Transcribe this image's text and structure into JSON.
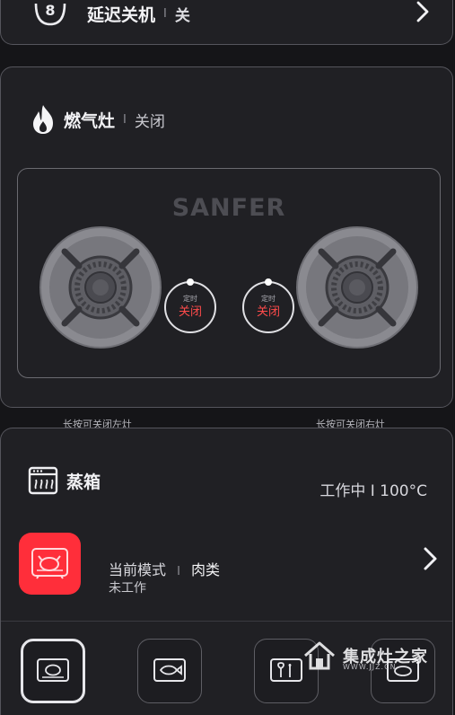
{
  "delay_off": {
    "title": "延迟关机",
    "separator": "I",
    "status": "关"
  },
  "gas_stove": {
    "title": "燃气灶",
    "separator": "I",
    "status": "关闭",
    "brand": "SANFER",
    "left_timer": {
      "label": "定时",
      "state": "关闭"
    },
    "right_timer": {
      "label": "定时",
      "state": "关闭"
    },
    "left_hint": "长按可关闭左灶",
    "right_hint": "长按可关闭右灶"
  },
  "steam_box": {
    "title": "蒸箱",
    "status": "工作中 I 100°C",
    "mode_label": "当前模式",
    "separator": "I",
    "mode_value": "肉类",
    "work_state": "未工作",
    "modes": [
      "meat-mode",
      "fish-mode",
      "vegetable-mode",
      "other-mode"
    ]
  },
  "watermark": {
    "name": "集成灶之家",
    "url": "WWW.JJZ.CN"
  },
  "colors": {
    "background": "#151518",
    "card": "#202024",
    "accent_red": "#ff2e3a",
    "timer_text": "#ff4b4b"
  }
}
